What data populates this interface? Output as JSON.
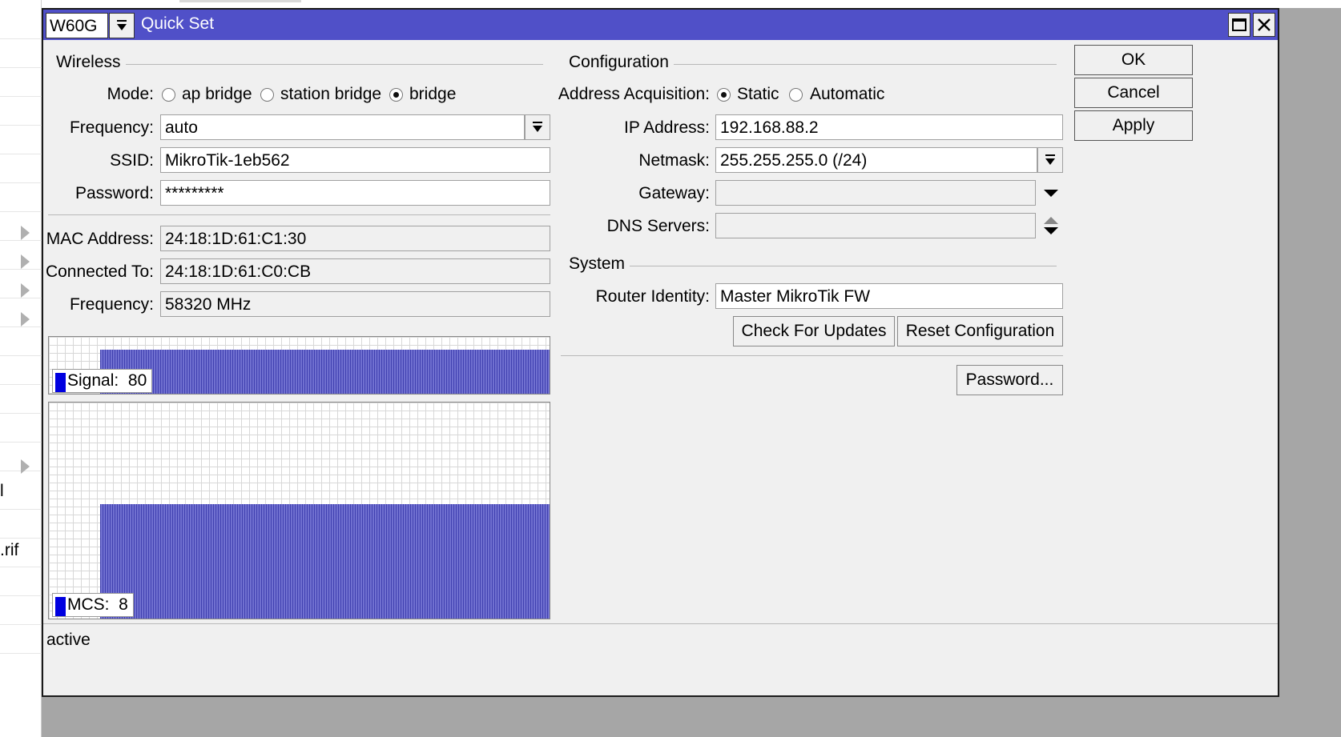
{
  "background_fragments": [
    "l",
    ".rif"
  ],
  "window": {
    "interface": "W60G",
    "title": "Quick Set"
  },
  "wireless": {
    "section": "Wireless",
    "mode_label": "Mode:",
    "modes": [
      {
        "label": "ap bridge",
        "selected": false
      },
      {
        "label": "station bridge",
        "selected": false
      },
      {
        "label": "bridge",
        "selected": true
      }
    ],
    "frequency_label": "Frequency:",
    "frequency": "auto",
    "ssid_label": "SSID:",
    "ssid": "MikroTik-1eb562",
    "password_label": "Password:",
    "password": "*********",
    "mac_label": "MAC Address:",
    "mac": "24:18:1D:61:C1:30",
    "connected_label": "Connected To:",
    "connected": "24:18:1D:61:C0:CB",
    "freq2_label": "Frequency:",
    "freq2": "58320 MHz",
    "signal_label": "Signal:",
    "signal_value": "80",
    "mcs_label": "MCS:",
    "mcs_value": "8"
  },
  "configuration": {
    "section": "Configuration",
    "addr_label": "Address Acquisition:",
    "addr_options": [
      {
        "label": "Static",
        "selected": true
      },
      {
        "label": "Automatic",
        "selected": false
      }
    ],
    "ip_label": "IP Address:",
    "ip": "192.168.88.2",
    "netmask_label": "Netmask:",
    "netmask": "255.255.255.0 (/24)",
    "gateway_label": "Gateway:",
    "gateway": "",
    "dns_label": "DNS Servers:",
    "dns": ""
  },
  "system": {
    "section": "System",
    "identity_label": "Router Identity:",
    "identity": "Master MikroTik FW",
    "check_updates": "Check For Updates",
    "reset_config": "Reset Configuration",
    "password_btn": "Password..."
  },
  "actions": {
    "ok": "OK",
    "cancel": "Cancel",
    "apply": "Apply"
  },
  "status": "active",
  "colors": {
    "titlebar": "#5050c8",
    "graph_bar": "#5454c0",
    "legend_swatch": "#0000e0"
  }
}
